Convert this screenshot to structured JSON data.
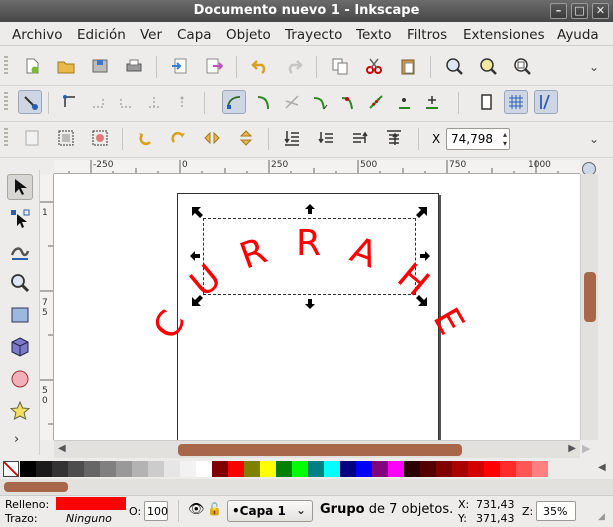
{
  "window": {
    "title": "Documento nuevo 1 - Inkscape"
  },
  "menu": [
    "Archivo",
    "Edición",
    "Ver",
    "Capa",
    "Objeto",
    "Trayecto",
    "Texto",
    "Filtros",
    "Extensiones",
    "Ayuda"
  ],
  "toolbar3": {
    "x_label": "X",
    "x_value": "74,798"
  },
  "ruler": {
    "h_ticks": [
      "-250",
      "0",
      "250",
      "500",
      "750",
      "1000"
    ],
    "v_ticks": [
      "1",
      "7",
      "5",
      "5",
      "0"
    ]
  },
  "canvas": {
    "text_letters": [
      "C",
      "U",
      "R",
      "R",
      "A",
      "H",
      "E"
    ]
  },
  "status": {
    "fill_label": "Relleno:",
    "stroke_label": "Trazo:",
    "stroke_value": "Ninguno",
    "opacity_label": "O:",
    "opacity_value": "100",
    "layer_value": "•Capa 1",
    "message_bold": "Grupo",
    "message_rest": " de 7 objetos.",
    "x_label": "X:",
    "x_value": "731,43",
    "y_label": "Y:",
    "y_value": "371,43",
    "zoom_label": "Z:",
    "zoom_value": "35%"
  },
  "colors": {
    "fill": "#ff0000",
    "palette": [
      "#000000",
      "#1a1a1a",
      "#333333",
      "#4d4d4d",
      "#666666",
      "#808080",
      "#999999",
      "#b3b3b3",
      "#cccccc",
      "#e6e6e6",
      "#f2f2f2",
      "#ffffff",
      "#800000",
      "#ff0000",
      "#808000",
      "#ffff00",
      "#008000",
      "#00ff00",
      "#008080",
      "#00ffff",
      "#000080",
      "#0000ff",
      "#800080",
      "#ff00ff",
      "#2b0000",
      "#550000",
      "#800000",
      "#aa0000",
      "#d40000",
      "#ff0000",
      "#ff2a2a",
      "#ff5555",
      "#ff8080"
    ]
  }
}
